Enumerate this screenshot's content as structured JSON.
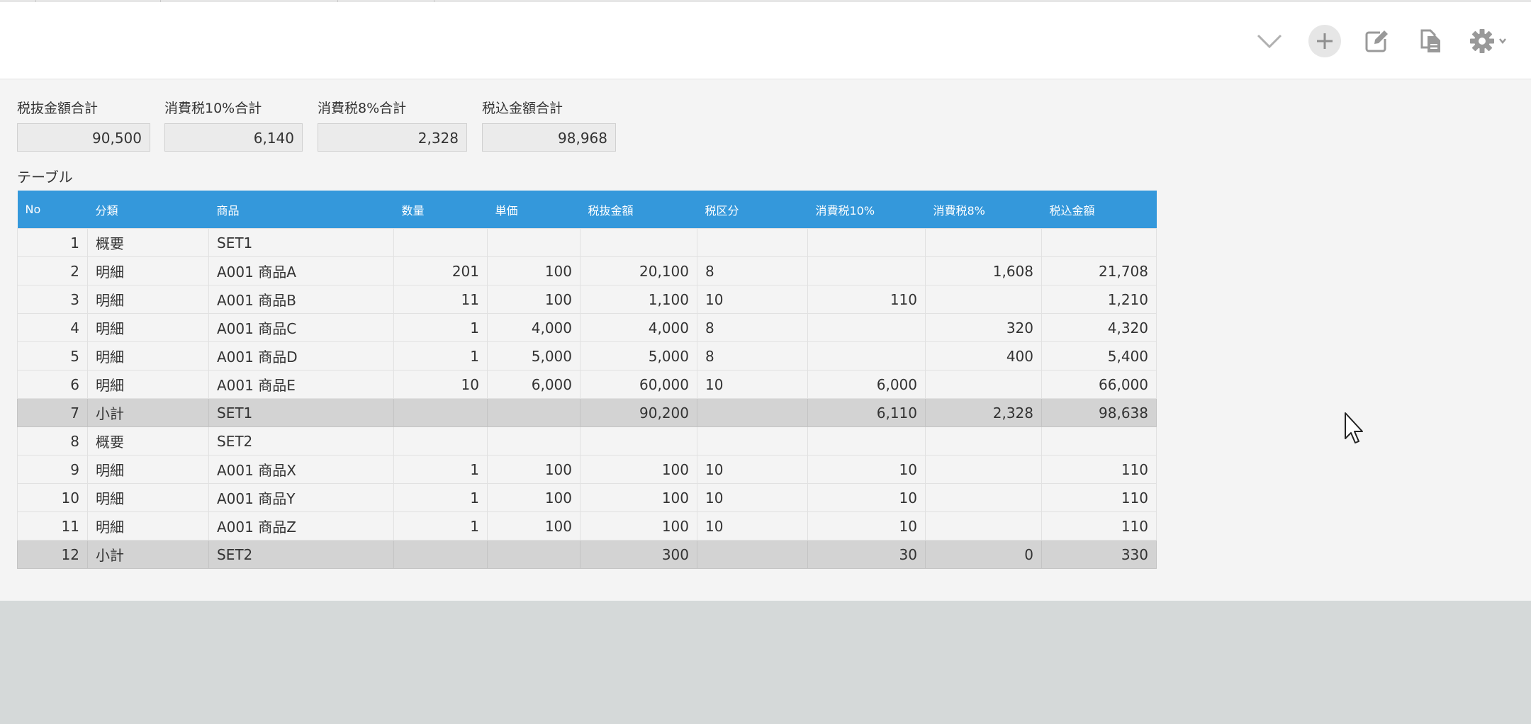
{
  "toolbar": {
    "icons": [
      "chevron-down-icon",
      "plus-icon",
      "edit-icon",
      "duplicate-icon",
      "gear-icon"
    ]
  },
  "summary": {
    "fields": [
      {
        "label": "税抜金額合計",
        "value": "90,500"
      },
      {
        "label": "消費税10%合計",
        "value": "6,140"
      },
      {
        "label": "消費税8%合計",
        "value": "2,328"
      },
      {
        "label": "税込金額合計",
        "value": "98,968"
      }
    ]
  },
  "table": {
    "label": "テーブル",
    "headers": [
      "No",
      "分類",
      "商品",
      "数量",
      "単価",
      "税抜金額",
      "税区分",
      "消費税10%",
      "消費税8%",
      "税込金額"
    ],
    "rows": [
      [
        "1",
        "概要",
        "SET1",
        "",
        "",
        "",
        "",
        "",
        "",
        ""
      ],
      [
        "2",
        "明細",
        "A001 商品A",
        "201",
        "100",
        "20,100",
        "8",
        "",
        "1,608",
        "21,708"
      ],
      [
        "3",
        "明細",
        "A001 商品B",
        "11",
        "100",
        "1,100",
        "10",
        "110",
        "",
        "1,210"
      ],
      [
        "4",
        "明細",
        "A001 商品C",
        "1",
        "4,000",
        "4,000",
        "8",
        "",
        "320",
        "4,320"
      ],
      [
        "5",
        "明細",
        "A001 商品D",
        "1",
        "5,000",
        "5,000",
        "8",
        "",
        "400",
        "5,400"
      ],
      [
        "6",
        "明細",
        "A001 商品E",
        "10",
        "6,000",
        "60,000",
        "10",
        "6,000",
        "",
        "66,000"
      ],
      [
        "7",
        "小計",
        "SET1",
        "",
        "",
        "90,200",
        "",
        "6,110",
        "2,328",
        "98,638"
      ],
      [
        "8",
        "概要",
        "SET2",
        "",
        "",
        "",
        "",
        "",
        "",
        ""
      ],
      [
        "9",
        "明細",
        "A001 商品X",
        "1",
        "100",
        "100",
        "10",
        "10",
        "",
        "110"
      ],
      [
        "10",
        "明細",
        "A001 商品Y",
        "1",
        "100",
        "100",
        "10",
        "10",
        "",
        "110"
      ],
      [
        "11",
        "明細",
        "A001 商品Z",
        "1",
        "100",
        "100",
        "10",
        "10",
        "",
        "110"
      ],
      [
        "12",
        "小計",
        "SET2",
        "",
        "",
        "300",
        "",
        "30",
        "0",
        "330"
      ]
    ]
  },
  "colors": {
    "header_bg": "#3498db",
    "subtotal_bg": "#d3d3d3",
    "content_bg": "#f4f4f4",
    "footer_bg": "#d5d9d9"
  }
}
